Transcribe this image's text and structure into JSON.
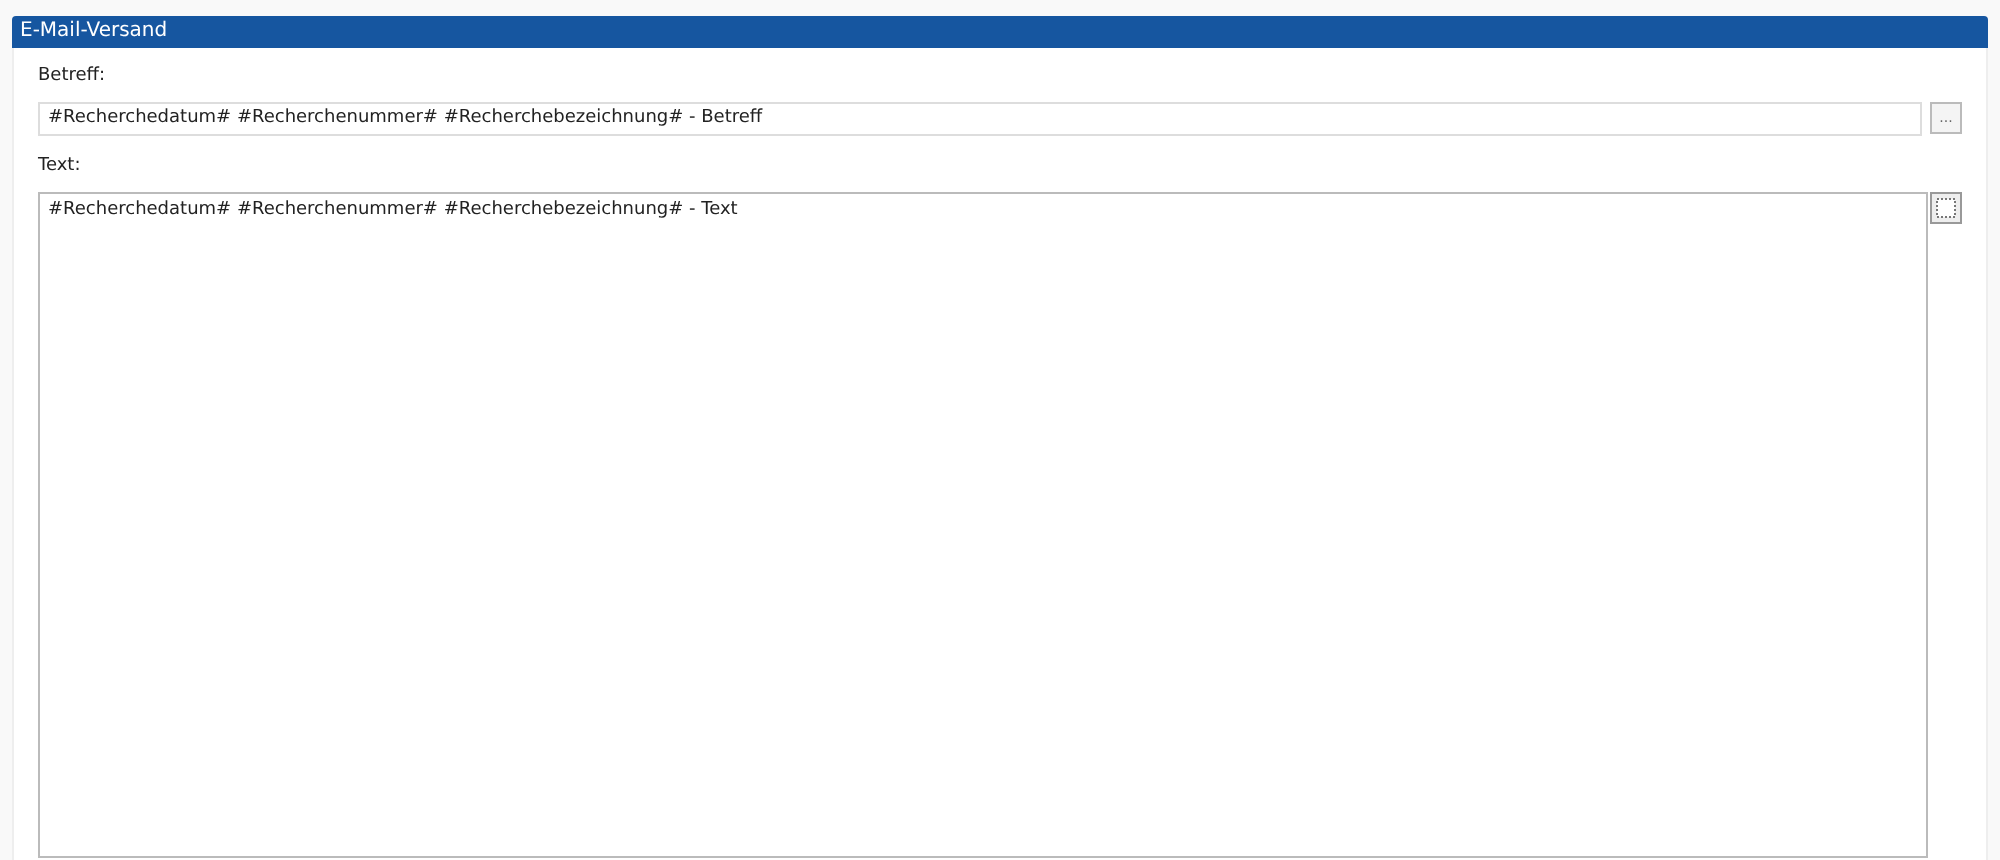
{
  "panel": {
    "title": "E-Mail-Versand"
  },
  "subject": {
    "label": "Betreff:",
    "value": "#Recherchedatum# #Recherchenummer# #Recherchebezeichnung# - Betreff",
    "button": "..."
  },
  "body": {
    "label": "Text:",
    "value": "#Recherchedatum# #Recherchenummer# #Recherchebezeichnung# - Text"
  }
}
